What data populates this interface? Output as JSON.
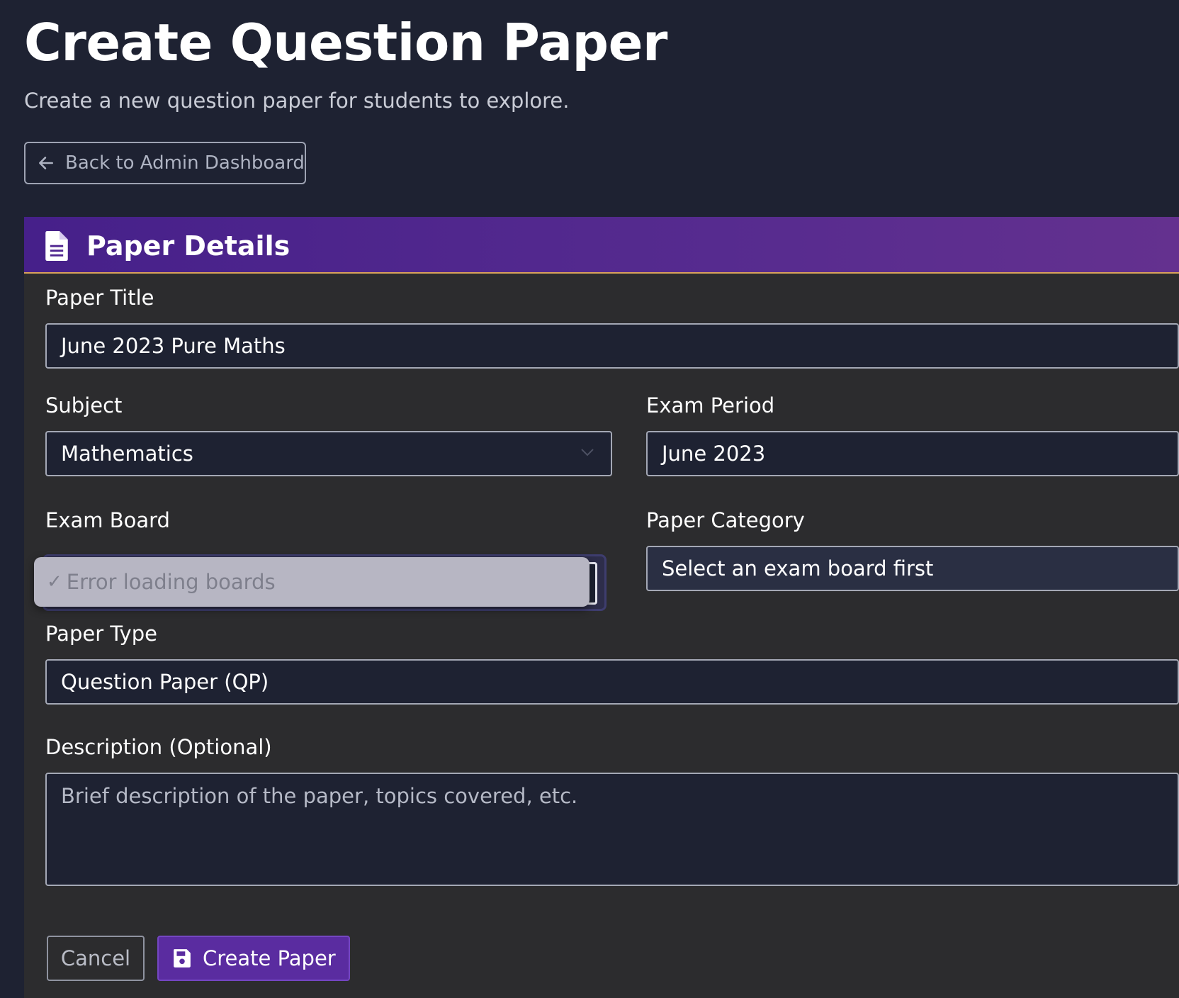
{
  "page": {
    "title": "Create Question Paper",
    "subtitle": "Create a new question paper for students to explore.",
    "back_button": "Back to Admin Dashboard"
  },
  "card": {
    "title": "Paper Details",
    "icon": "document-icon"
  },
  "form": {
    "paper_title": {
      "label": "Paper Title",
      "value": "June 2023 Pure Maths"
    },
    "subject": {
      "label": "Subject",
      "value": "Mathematics"
    },
    "exam_period": {
      "label": "Exam Period",
      "value": "June 2023"
    },
    "exam_board": {
      "label": "Exam Board",
      "dropdown_option": "Error loading boards",
      "dropdown_check": "✓"
    },
    "paper_category": {
      "label": "Paper Category",
      "value": "Select an exam board first"
    },
    "paper_type": {
      "label": "Paper Type",
      "value": "Question Paper (QP)"
    },
    "description": {
      "label": "Description (Optional)",
      "placeholder": "Brief description of the paper, topics covered, etc."
    }
  },
  "actions": {
    "cancel": "Cancel",
    "create": "Create Paper"
  },
  "colors": {
    "background": "#1e2232",
    "card": "#2c2c2e",
    "header_gradient_start": "#46208a",
    "header_gradient_end": "#64318f",
    "header_border": "#d9a35b",
    "primary_button": "#5a2ca0"
  }
}
